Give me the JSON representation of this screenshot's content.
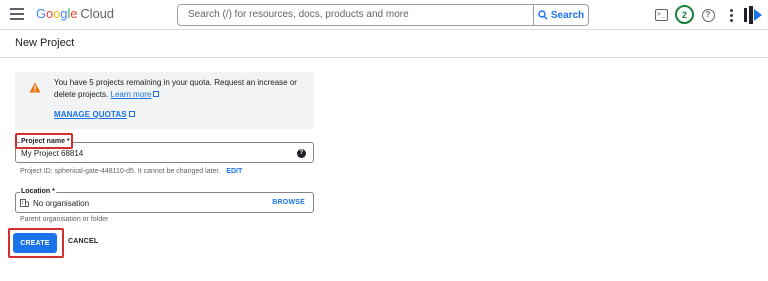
{
  "header": {
    "logo_google": "Google",
    "logo_cloud": "Cloud",
    "search_placeholder": "Search (/) for resources, docs, products and more",
    "search_button": "Search",
    "terminal_glyph": ">_",
    "notification_count": "2",
    "help_glyph": "?"
  },
  "page": {
    "title": "New Project"
  },
  "quota_notice": {
    "text": "You have 5 projects remaining in your quota. Request an increase or delete projects.",
    "learn_more": "Learn more",
    "manage_quotas": "MANAGE QUOTAS"
  },
  "project_name": {
    "label": "Project name *",
    "value": "My Project 68814",
    "help_glyph": "?"
  },
  "project_id": {
    "text": "Project ID: spherical-gate-448110-d5. It cannot be changed later.",
    "edit": "EDIT"
  },
  "location": {
    "label": "Location *",
    "value": "No organisation",
    "browse": "BROWSE",
    "helper": "Parent organisation or folder"
  },
  "actions": {
    "create": "CREATE",
    "cancel": "CANCEL"
  },
  "colors": {
    "accent": "#1a73e8",
    "highlight": "#d32f2f",
    "warning": "#e8710a",
    "badge": "#188038"
  }
}
